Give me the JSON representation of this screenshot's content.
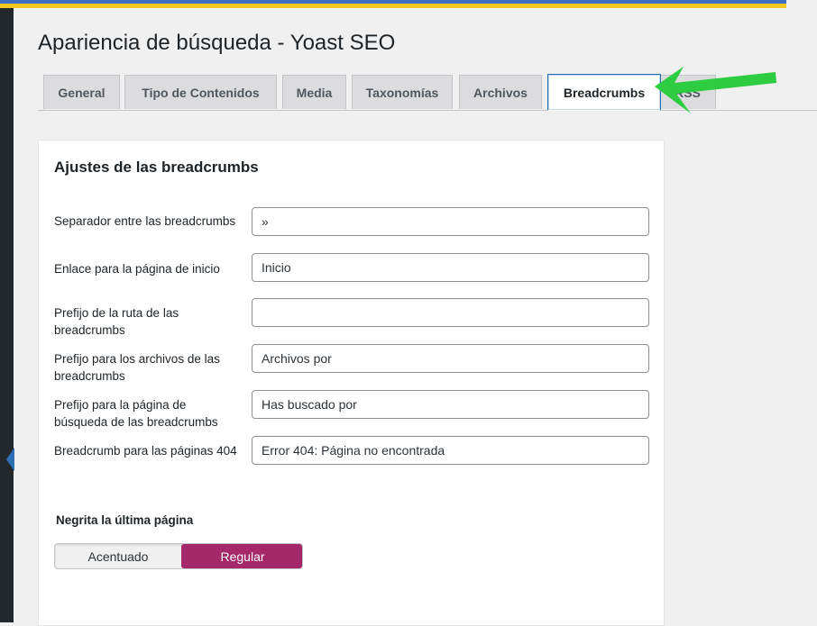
{
  "page": {
    "title": "Apariencia de búsqueda - Yoast SEO"
  },
  "tabs": [
    {
      "label": "General"
    },
    {
      "label": "Tipo de Contenidos"
    },
    {
      "label": "Media"
    },
    {
      "label": "Taxonomías"
    },
    {
      "label": "Archivos"
    },
    {
      "label": "Breadcrumbs",
      "active": true
    },
    {
      "label": "RSS"
    }
  ],
  "settings": {
    "title": "Ajustes de las breadcrumbs",
    "fields": [
      {
        "label": "Separador entre las breadcrumbs",
        "value": "»"
      },
      {
        "label": "Enlace para la página de inicio",
        "value": "Inicio"
      },
      {
        "label": "Prefijo de la ruta de las breadcrumbs",
        "value": ""
      },
      {
        "label": "Prefijo para los archivos de las breadcrumbs",
        "value": "Archivos por"
      },
      {
        "label": "Prefijo para la página de búsqueda de las breadcrumbs",
        "value": "Has buscado por"
      },
      {
        "label": "Breadcrumb para las páginas 404",
        "value": "Error 404: Página no encontrada"
      }
    ],
    "bold_last_page": {
      "label": "Negrita la última página",
      "options": [
        "Acentuado",
        "Regular"
      ],
      "selected": "Regular"
    }
  },
  "colors": {
    "accent": "#a4286a",
    "arrow": "#2ecc40",
    "active_tab_border": "#2271b1",
    "sidebar": "#23282d"
  },
  "icons": {
    "annotation": "green-arrow-icon",
    "menu_pointer": "sidebar-pointer-icon"
  }
}
